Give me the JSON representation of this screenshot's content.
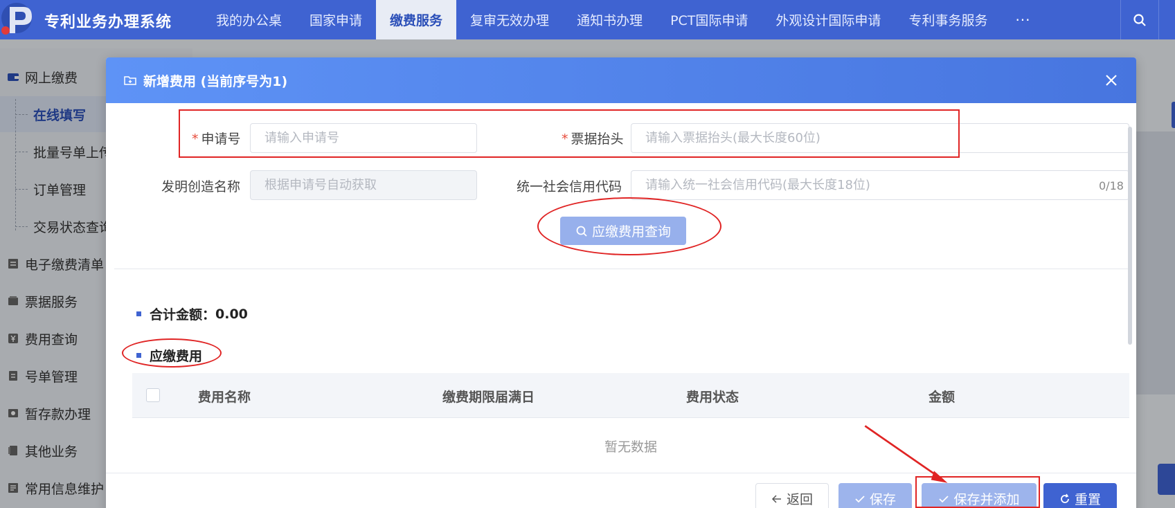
{
  "app": {
    "title": "专利业务办理系统"
  },
  "nav": {
    "items": [
      "我的办公桌",
      "国家申请",
      "缴费服务",
      "复审无效办理",
      "通知书办理",
      "PCT国际申请",
      "外观设计国际申请",
      "专利事务服务"
    ],
    "active_index": 2,
    "more": "···"
  },
  "sidebar": {
    "group": "网上缴费",
    "subs": [
      "在线填写",
      "批量号单上传",
      "订单管理",
      "交易状态查询"
    ],
    "active_sub": 0,
    "items": [
      "电子缴费清单",
      "票据服务",
      "费用查询",
      "号单管理",
      "暂存款办理",
      "其他业务",
      "常用信息维护"
    ]
  },
  "modal": {
    "title": "新增费用 (当前序号为1)",
    "fields": {
      "app_no": {
        "label": "申请号",
        "placeholder": "请输入申请号",
        "required": true
      },
      "invoice_title": {
        "label": "票据抬头",
        "placeholder": "请输入票据抬头(最大长度60位)",
        "required": true
      },
      "invention_name": {
        "label": "发明创造名称",
        "placeholder": "根据申请号自动获取"
      },
      "credit_code": {
        "label": "统一社会信用代码",
        "placeholder": "请输入统一社会信用代码(最大长度18位)",
        "counter": "0/18"
      }
    },
    "query_button": "应缴费用查询",
    "total_label": "合计金额：",
    "total_value": "0.00",
    "fees_section": "应缴费用",
    "table": {
      "columns": [
        "费用名称",
        "缴费期限届满日",
        "费用状态",
        "金额"
      ],
      "empty_text": "暂无数据"
    },
    "buttons": {
      "back": "返回",
      "save": "保存",
      "save_add": "保存并添加",
      "reset": "重置"
    }
  },
  "colors": {
    "primary": "#3f63d1",
    "header_gradient_start": "#5e93f6",
    "annotation": "#e02424"
  }
}
